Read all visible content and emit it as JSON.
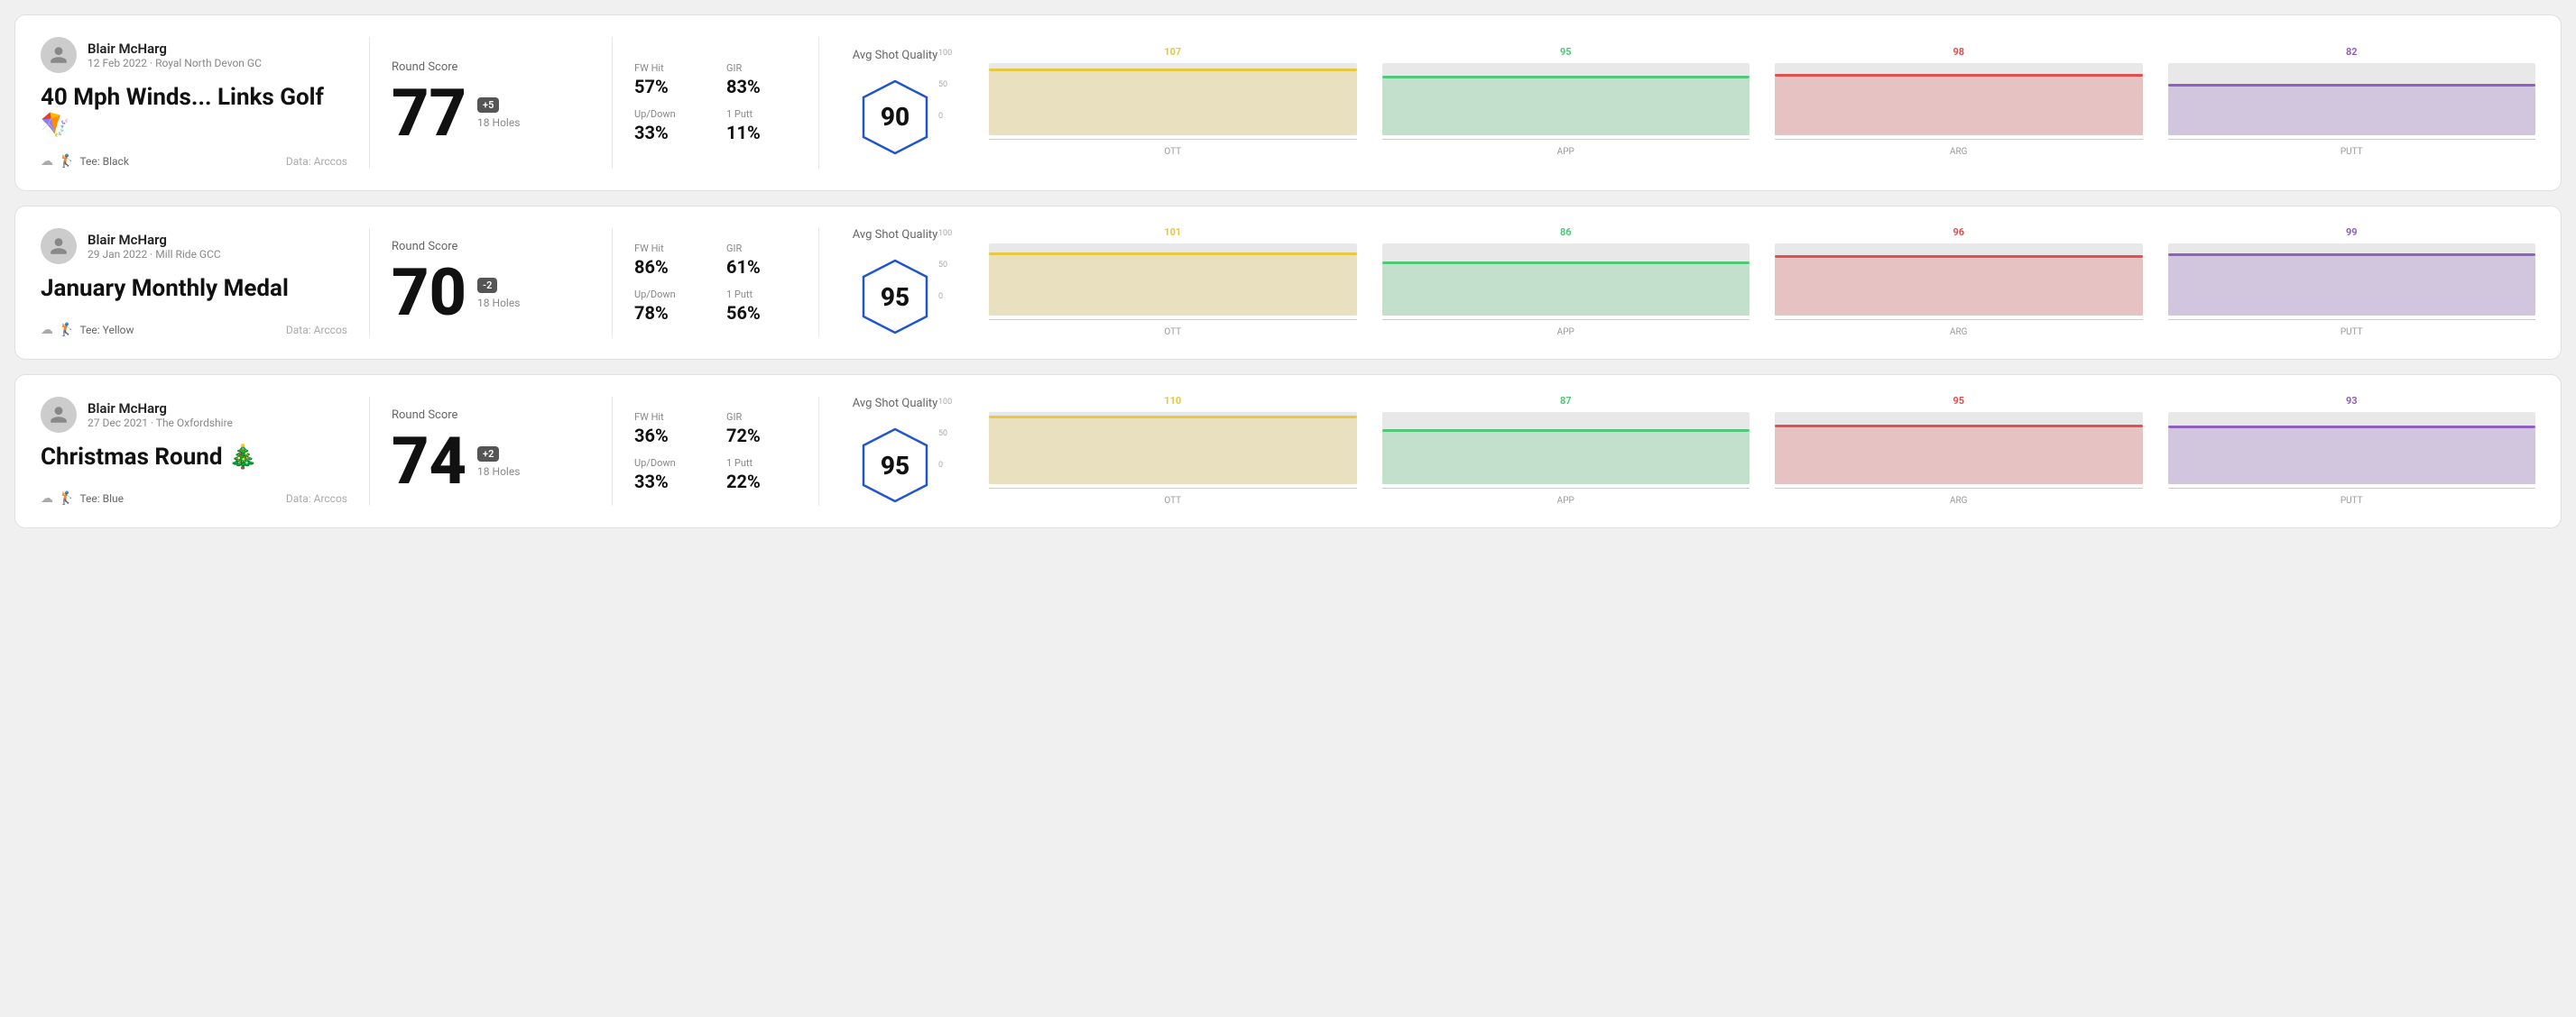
{
  "rounds": [
    {
      "id": "round1",
      "user": {
        "name": "Blair McHarg",
        "date": "12 Feb 2022",
        "course": "Royal North Devon GC"
      },
      "title": "40 Mph Winds... Links Golf 🪁",
      "tee": "Black",
      "data_source": "Data: Arccos",
      "score": "77",
      "score_diff": "+5",
      "holes": "18 Holes",
      "fw_hit": "57%",
      "gir": "83%",
      "up_down": "33%",
      "one_putt": "11%",
      "avg_quality": "90",
      "chart": {
        "bars": [
          {
            "label": "OTT",
            "value": 107,
            "color": "#e8c840"
          },
          {
            "label": "APP",
            "value": 95,
            "color": "#50c878"
          },
          {
            "label": "ARG",
            "value": 98,
            "color": "#e05050"
          },
          {
            "label": "PUTT",
            "value": 82,
            "color": "#9060c0"
          }
        ]
      }
    },
    {
      "id": "round2",
      "user": {
        "name": "Blair McHarg",
        "date": "29 Jan 2022",
        "course": "Mill Ride GCC"
      },
      "title": "January Monthly Medal",
      "tee": "Yellow",
      "data_source": "Data: Arccos",
      "score": "70",
      "score_diff": "-2",
      "holes": "18 Holes",
      "fw_hit": "86%",
      "gir": "61%",
      "up_down": "78%",
      "one_putt": "56%",
      "avg_quality": "95",
      "chart": {
        "bars": [
          {
            "label": "OTT",
            "value": 101,
            "color": "#e8c840"
          },
          {
            "label": "APP",
            "value": 86,
            "color": "#50c878"
          },
          {
            "label": "ARG",
            "value": 96,
            "color": "#e05050"
          },
          {
            "label": "PUTT",
            "value": 99,
            "color": "#9060c0"
          }
        ]
      }
    },
    {
      "id": "round3",
      "user": {
        "name": "Blair McHarg",
        "date": "27 Dec 2021",
        "course": "The Oxfordshire"
      },
      "title": "Christmas Round 🎄",
      "tee": "Blue",
      "data_source": "Data: Arccos",
      "score": "74",
      "score_diff": "+2",
      "holes": "18 Holes",
      "fw_hit": "36%",
      "gir": "72%",
      "up_down": "33%",
      "one_putt": "22%",
      "avg_quality": "95",
      "chart": {
        "bars": [
          {
            "label": "OTT",
            "value": 110,
            "color": "#e8c840"
          },
          {
            "label": "APP",
            "value": 87,
            "color": "#50c878"
          },
          {
            "label": "ARG",
            "value": 95,
            "color": "#e05050"
          },
          {
            "label": "PUTT",
            "value": 93,
            "color": "#9060c0"
          }
        ]
      }
    }
  ],
  "labels": {
    "round_score": "Round Score",
    "fw_hit": "FW Hit",
    "gir": "GIR",
    "up_down": "Up/Down",
    "one_putt": "1 Putt",
    "avg_shot_quality": "Avg Shot Quality",
    "tee_prefix": "Tee:",
    "y_axis": [
      "100",
      "50",
      "0"
    ]
  }
}
